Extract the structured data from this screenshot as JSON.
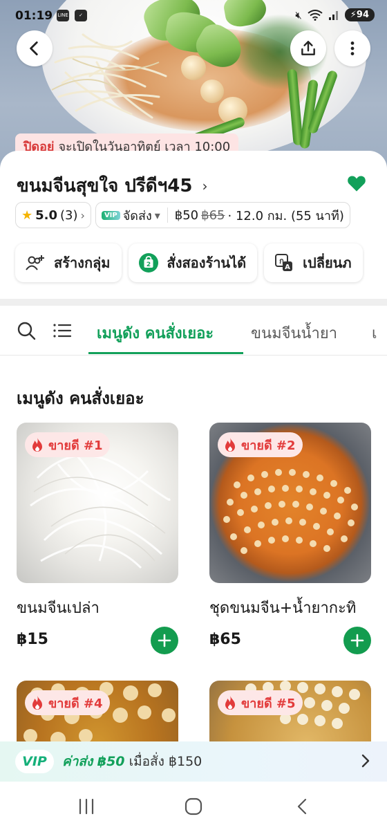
{
  "status_bar": {
    "time": "01:19",
    "battery": "94",
    "icons": [
      "line-icon",
      "check-icon",
      "mute-icon",
      "wifi-icon",
      "signal-icon"
    ]
  },
  "header": {
    "closed_label": "ปิดอยู่",
    "open_note": "จะเปิดในวันอาทิตย์ เวลา 10:00"
  },
  "store": {
    "name": "ขนมจีนสุขใจ ปรีดีฯ45",
    "favorited": true,
    "rating": "5.0",
    "rating_count": "(3)",
    "vip_tag": "VIP",
    "delivery_mode": "จัดส่ง",
    "delivery_fee": "฿50",
    "delivery_fee_old": "฿65",
    "distance_time": "· 12.0 กม. (55 นาที)"
  },
  "actions": [
    {
      "label": "สร้างกลุ่ม",
      "icon": "add-group-icon"
    },
    {
      "label": "สั่งสองร้านได้",
      "icon": "two-store-bag-icon"
    },
    {
      "label": "เปลี่ยนภ",
      "icon": "translate-icon"
    }
  ],
  "tabs": [
    {
      "label": "เมนูดัง คนสั่งเยอะ",
      "active": true
    },
    {
      "label": "ขนมจีนน้ำยา",
      "active": false
    },
    {
      "label": "เ",
      "active": false
    }
  ],
  "section_title": "เมนูดัง คนสั่งเยอะ",
  "items": [
    {
      "badge": "ขายดี #1",
      "name": "ขนมจีนเปล่า",
      "price": "฿15"
    },
    {
      "badge": "ขายดี #2",
      "name": "ชุดขนมจีน+น้ำยากะทิ",
      "price": "฿65"
    },
    {
      "badge": "ขายดี #4",
      "name": "",
      "price": ""
    },
    {
      "badge": "ขายดี #5",
      "name": "",
      "price": ""
    }
  ],
  "vip_bar": {
    "pill": "VIP",
    "fee_label": "ค่าส่ง ฿50",
    "condition": "เมื่อสั่ง ฿150"
  },
  "colors": {
    "brand_green": "#12a05a",
    "closed_red": "#d83a3a",
    "badge_red": "#e23b3b",
    "badge_bg": "#fde7e7"
  }
}
